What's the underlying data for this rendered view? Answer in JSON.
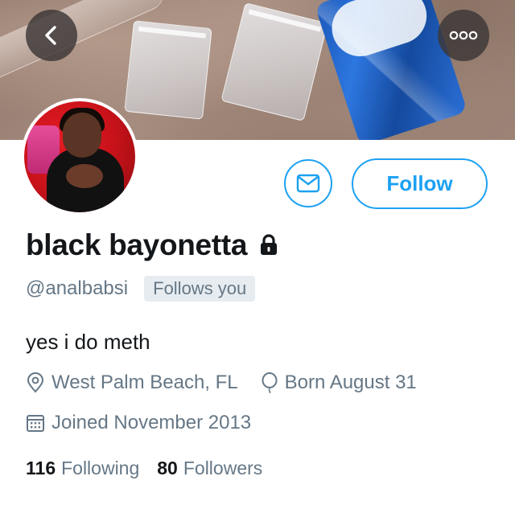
{
  "profile": {
    "display_name": "black bayonetta",
    "handle": "@analbabsi",
    "follows_you_badge": "Follows you",
    "bio": "yes i do meth",
    "location": "West Palm Beach, FL",
    "birthday": "Born August 31",
    "joined": "Joined November 2013",
    "protected": true
  },
  "actions": {
    "follow_label": "Follow"
  },
  "stats": {
    "following_count": "116",
    "following_label": "Following",
    "followers_count": "80",
    "followers_label": "Followers"
  },
  "icons": {
    "back": "chevron-left-icon",
    "more": "more-dots-icon",
    "message": "envelope-icon",
    "lock": "lock-icon",
    "location": "location-pin-icon",
    "birthday": "balloon-icon",
    "joined": "calendar-icon"
  },
  "colors": {
    "accent": "#1da1f2",
    "primary_text": "#14171a",
    "secondary_text": "#657786",
    "badge_bg": "#e6ecf0"
  }
}
